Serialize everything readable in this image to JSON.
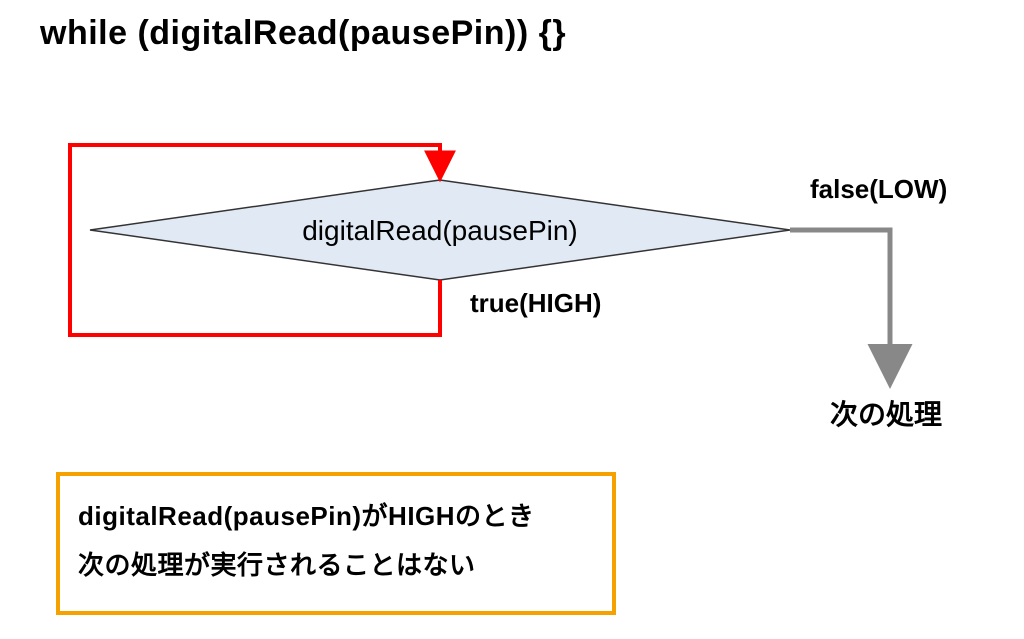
{
  "title": "while (digitalRead(pausePin)) {}",
  "diamond": {
    "text": "digitalRead(pausePin)",
    "fill": "#e1e9f4",
    "stroke": "#333333"
  },
  "labels": {
    "true": "true(HIGH)",
    "false": "false(LOW)",
    "next": "次の処理"
  },
  "loop_arrow_color": "#ff0000",
  "false_arrow_color": "#888888",
  "note": {
    "border_color": "#f5a100",
    "line1": "digitalRead(pausePin)がHIGHのとき",
    "line2": "次の処理が実行されることはない"
  },
  "chart_data": {
    "type": "flowchart",
    "nodes": [
      {
        "id": "decision",
        "shape": "diamond",
        "text": "digitalRead(pausePin)"
      },
      {
        "id": "next",
        "shape": "terminal",
        "text": "次の処理"
      }
    ],
    "edges": [
      {
        "from": "decision",
        "to": "decision",
        "label": "true(HIGH)",
        "color": "#ff0000",
        "loop": true
      },
      {
        "from": "decision",
        "to": "next",
        "label": "false(LOW)",
        "color": "#888888"
      }
    ],
    "title": "while (digitalRead(pausePin)) {}",
    "annotation": "digitalRead(pausePin)がHIGHのとき 次の処理が実行されることはない"
  }
}
